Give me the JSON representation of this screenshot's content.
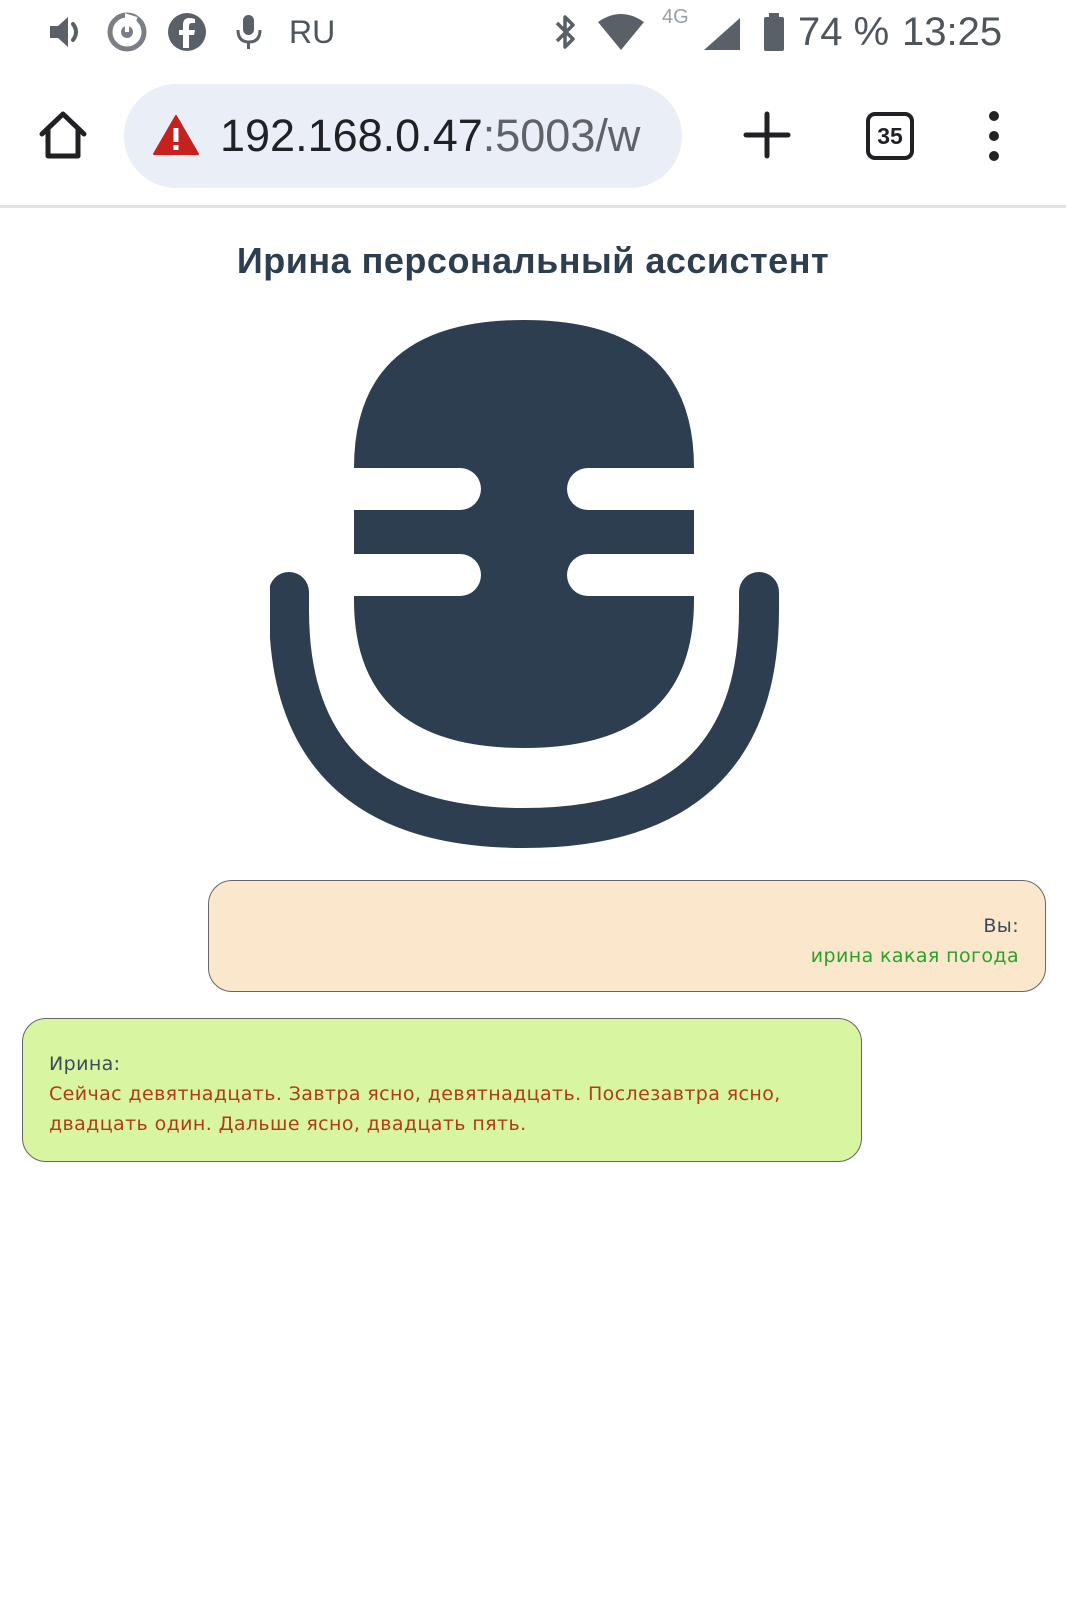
{
  "status_bar": {
    "language": "RU",
    "network": "4G",
    "battery_percent": "74 %",
    "time": "13:25",
    "icons": [
      "volume-icon",
      "music-icon",
      "facebook-icon",
      "microphone-icon",
      "bluetooth-icon",
      "wifi-icon",
      "cellular-signal-icon",
      "battery-icon"
    ]
  },
  "browser": {
    "url_host": "192.168.0.47",
    "url_rest": ":5003/w",
    "tab_count": "35",
    "icons": [
      "home-icon",
      "not-secure-warning-icon",
      "new-tab-plus-icon",
      "tabs-counter-icon",
      "more-menu-icon"
    ]
  },
  "page": {
    "title": "Ирина персональный ассистент",
    "mic_icon": "microphone-icon",
    "mic_color": "#2d3e50",
    "messages": [
      {
        "role": "user",
        "speaker": "Вы:",
        "text": "ирина какая погода",
        "bg_color": "#fbe8cc",
        "text_color": "#2aa12a"
      },
      {
        "role": "assistant",
        "speaker": "Ирина:",
        "text": "Сейчас девятнадцать. Завтра ясно, девятнадцать. Послезавтра ясно, двадцать один. Дальше ясно, двадцать пять.",
        "bg_color": "#d8f5a2",
        "text_color": "#b03a1a"
      }
    ]
  }
}
